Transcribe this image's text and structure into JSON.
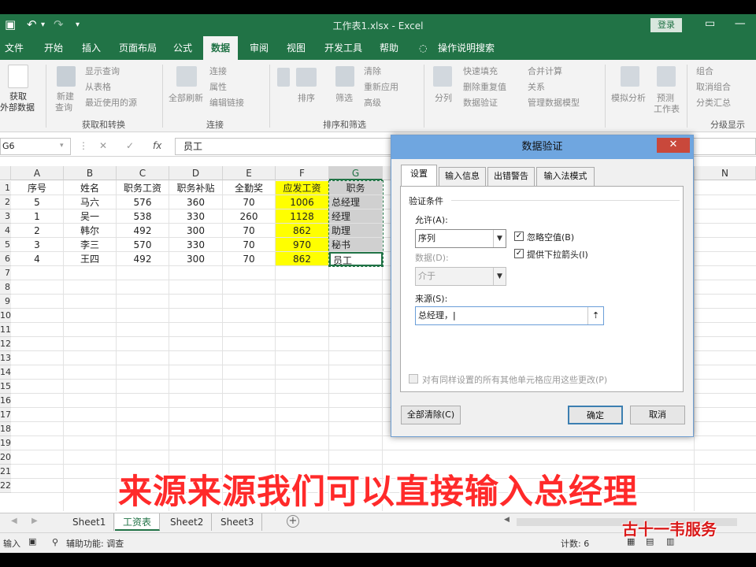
{
  "app": {
    "title": "工作表1.xlsx  -  Excel",
    "login_label": "登录",
    "undo_label": "↶",
    "redo_label": "↷"
  },
  "tabs": [
    "文件",
    "开始",
    "插入",
    "页面布局",
    "公式",
    "数据",
    "审阅",
    "视图",
    "开发工具",
    "帮助",
    "操作说明搜索"
  ],
  "active_tab": "数据",
  "ribbon": {
    "get_data": "获取",
    "get_data2": "外部数据",
    "new_query": "新建",
    "new_query2": "查询",
    "show_query": "显示查询",
    "from_table": "从表格",
    "recent_sources": "最近使用的源",
    "group_get_transform": "获取和转换",
    "refresh_all": "全部刷新",
    "connections": "连接",
    "properties": "属性",
    "edit_links": "编辑链接",
    "group_connections": "连接",
    "sort": "排序",
    "filter": "筛选",
    "clear": "清除",
    "reapply": "重新应用",
    "advanced": "高级",
    "group_sort_filter": "排序和筛选",
    "split": "分列",
    "flash_fill": "快速填充",
    "remove_dup": "删除重复值",
    "data_validation": "数据验证",
    "consolidate": "合并计算",
    "relationships": "关系",
    "manage_model": "管理数据模型",
    "group_data_tools": "数据工具",
    "what_if": "模拟分析",
    "forecast_sheet": "预测",
    "forecast_sheet2": "工作表",
    "group_forecast": "预测",
    "group": "组合",
    "ungroup": "取消组合",
    "subtotal": "分类汇总",
    "group_outline": "分级显示"
  },
  "formula_bar": {
    "name_box": "G6",
    "fx": "fx",
    "content": "员工"
  },
  "columns": [
    "A",
    "B",
    "C",
    "D",
    "E",
    "F",
    "G",
    "N"
  ],
  "table": {
    "header": [
      "序号",
      "姓名",
      "职务工资",
      "职务补贴",
      "全勤奖",
      "应发工资",
      "职务"
    ],
    "rows": [
      [
        "5",
        "马六",
        "576",
        "360",
        "70",
        "1006",
        "总经理"
      ],
      [
        "1",
        "吴一",
        "538",
        "330",
        "260",
        "1128",
        "经理"
      ],
      [
        "2",
        "韩尔",
        "492",
        "300",
        "70",
        "862",
        "助理"
      ],
      [
        "3",
        "李三",
        "570",
        "330",
        "70",
        "970",
        "秘书"
      ],
      [
        "4",
        "王四",
        "492",
        "300",
        "70",
        "862",
        "员工"
      ]
    ]
  },
  "row_numbers": [
    "1",
    "2",
    "3",
    "4",
    "5",
    "6",
    "7",
    "8",
    "9",
    "10",
    "11",
    "12",
    "13",
    "14",
    "15",
    "16",
    "17",
    "18",
    "19",
    "20",
    "21",
    "22"
  ],
  "sheets": [
    "Sheet1",
    "工资表",
    "Sheet2",
    "Sheet3"
  ],
  "active_sheet": "工资表",
  "status": {
    "mode": "输入",
    "accessibility": "辅助功能: 调查",
    "count": "计数: 6"
  },
  "dialog": {
    "title": "数据验证",
    "tabs": [
      "设置",
      "输入信息",
      "出错警告",
      "输入法模式"
    ],
    "active_tab": "设置",
    "section": "验证条件",
    "allow_label": "允许(A):",
    "allow_value": "序列",
    "ignore_blank": "忽略空值(B)",
    "ignore_blank_checked": true,
    "dropdown": "提供下拉箭头(I)",
    "dropdown_checked": true,
    "data_label": "数据(D):",
    "data_value": "介于",
    "source_label": "来源(S):",
    "source_value": "总经理，",
    "apply_all": "对有同样设置的所有其他单元格应用这些更改(P)",
    "clear_all": "全部清除(C)",
    "ok": "确定",
    "cancel": "取消",
    "close": "✕"
  },
  "caption": "来源来源我们可以直接输入总经理",
  "watermark": "古十一韦服务"
}
